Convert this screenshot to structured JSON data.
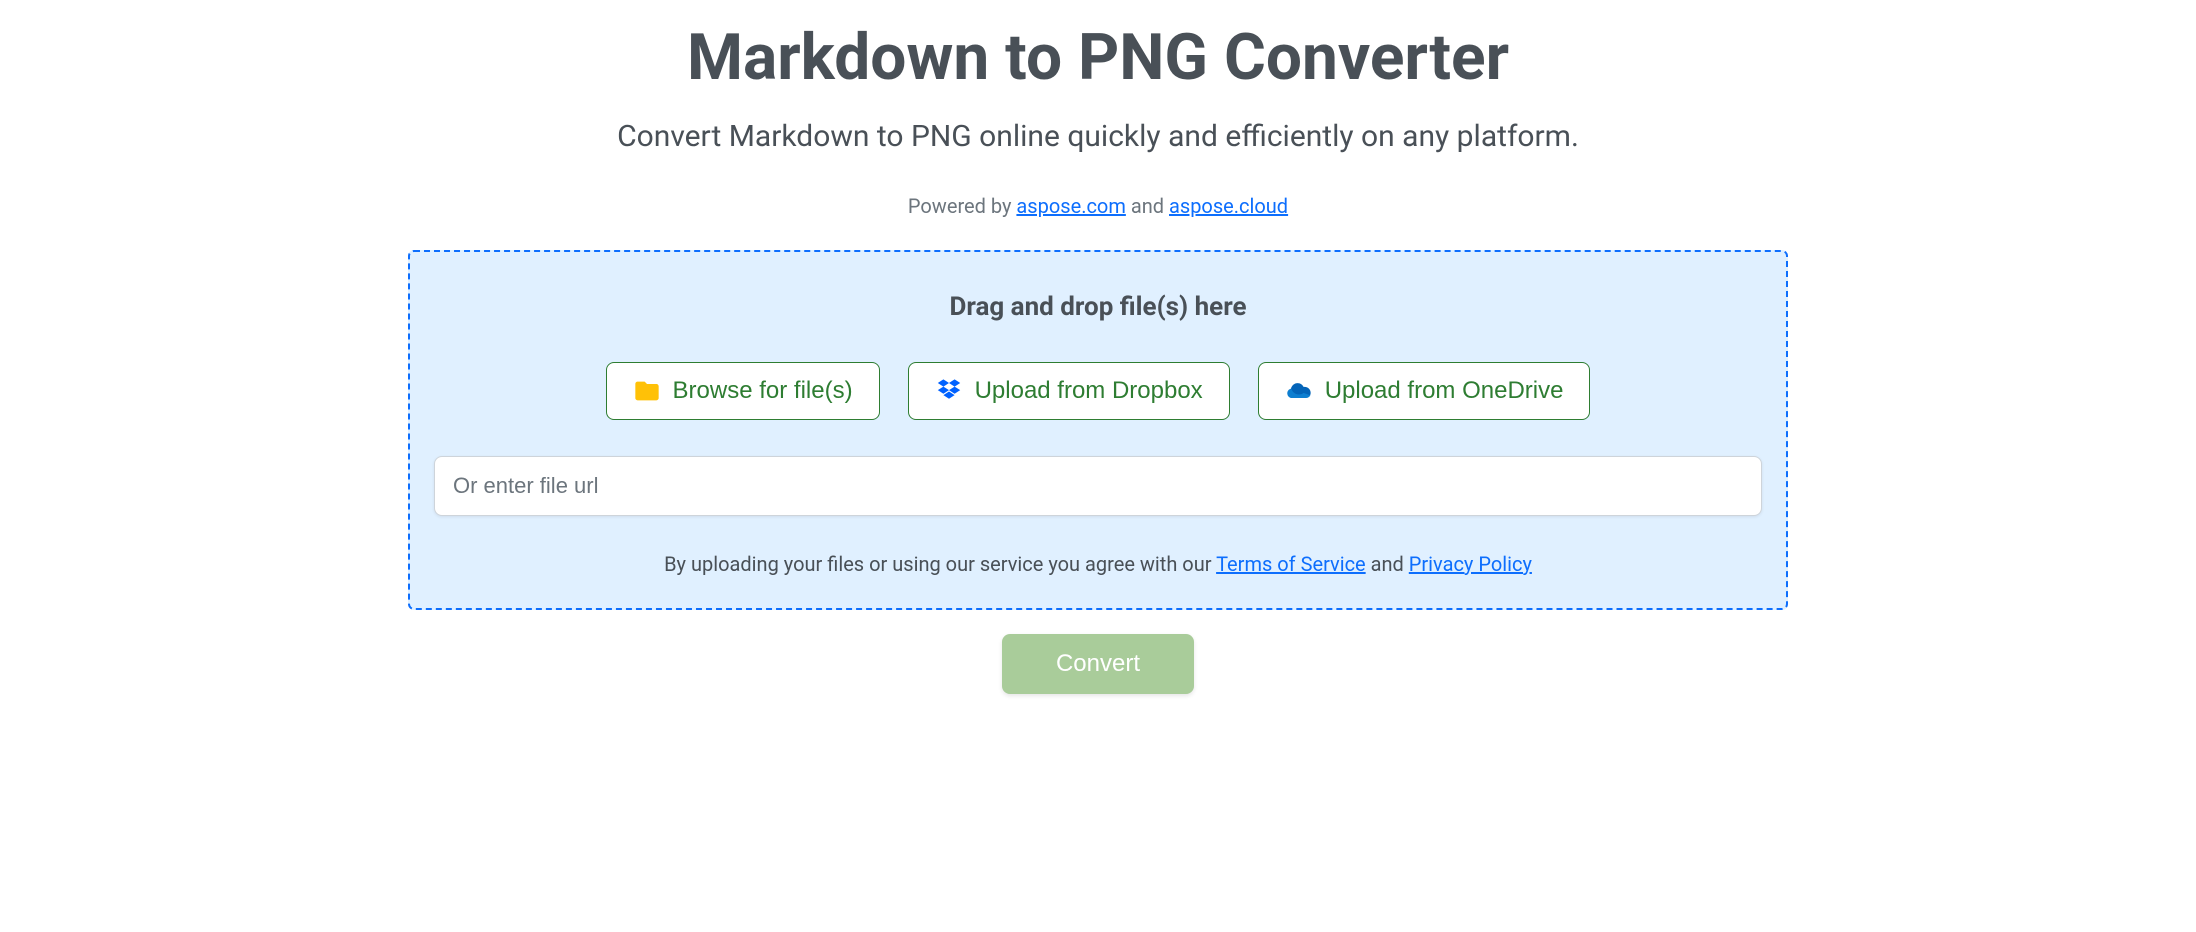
{
  "header": {
    "title": "Markdown to PNG Converter",
    "subtitle": "Convert Markdown to PNG online quickly and efficiently on any platform.",
    "powered_prefix": "Powered by ",
    "powered_link1": "aspose.com",
    "powered_and": " and ",
    "powered_link2": "aspose.cloud"
  },
  "dropzone": {
    "drag_text": "Drag and drop file(s) here",
    "browse_label": "Browse for file(s)",
    "dropbox_label": "Upload from Dropbox",
    "onedrive_label": "Upload from OneDrive",
    "url_placeholder": "Or enter file url",
    "agreement_prefix": "By uploading your files or using our service you agree with our ",
    "tos_label": "Terms of Service",
    "agreement_and": " and ",
    "privacy_label": "Privacy Policy"
  },
  "actions": {
    "convert_label": "Convert"
  }
}
